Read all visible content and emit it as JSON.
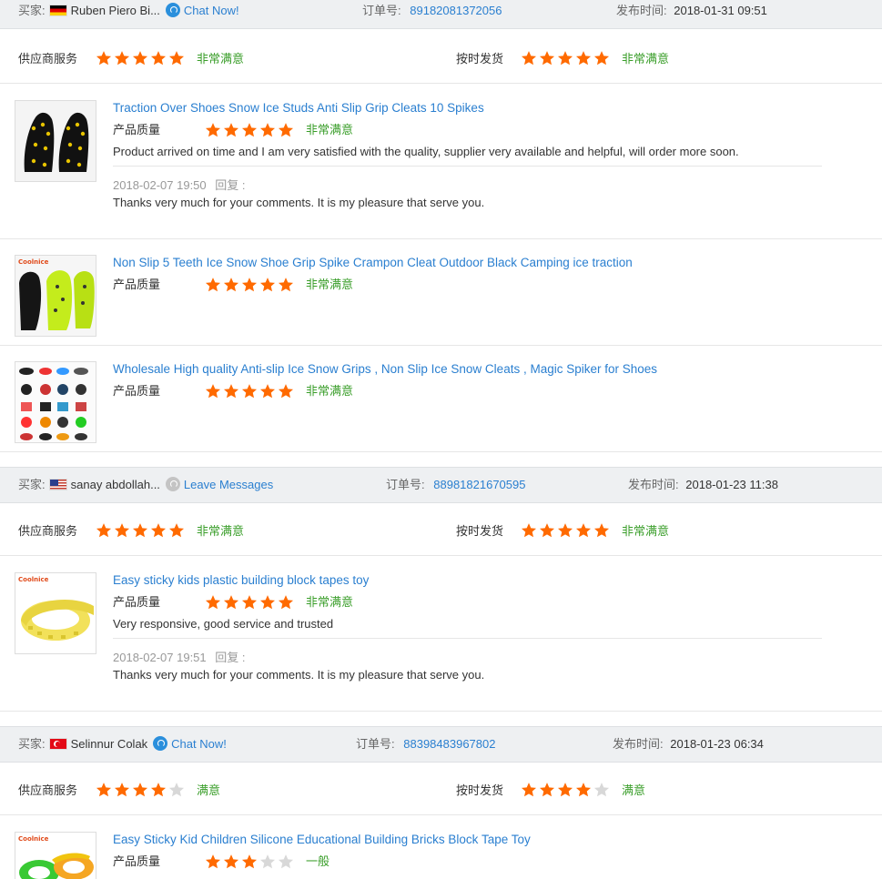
{
  "labels": {
    "buyer": "买家:",
    "order_no": "订单号:",
    "publish_time": "发布时间:",
    "supplier_service": "供应商服务",
    "on_time_delivery": "按时发货",
    "product_quality": "产品质量",
    "reply": "回复 :"
  },
  "colors": {
    "star": "#ff6a00",
    "link": "#2a7fd0",
    "verdict": "#3a9e2a",
    "header_bg": "#eef0f2"
  },
  "orders": [
    {
      "buyer_name": "Ruben Piero Bi...",
      "country_flag": "germany-flag",
      "contact_icon": "chat-icon",
      "contact_label": "Chat Now!",
      "order_number": "89182081372056",
      "publish_time": "2018-01-31 09:51",
      "supplier_service": {
        "stars": 5,
        "verdict": "非常满意"
      },
      "on_time_delivery": {
        "stars": 5,
        "verdict": "非常满意"
      },
      "products": [
        {
          "title": "Traction Over Shoes Snow Ice Studs Anti Slip Grip Cleats 10 Spikes",
          "quality_stars": 5,
          "quality_verdict": "非常满意",
          "review": "Product arrived on time and I am very satisfied with the quality, supplier very available and helpful, will order more soon.",
          "reply_date": "2018-02-07 19:50",
          "reply": "Thanks very much for your comments. It is my pleasure that serve you."
        },
        {
          "title": "Non Slip 5 Teeth Ice Snow Shoe Grip Spike Crampon Cleat Outdoor Black Camping ice traction",
          "thumb_brand": "Coolnice",
          "quality_stars": 5,
          "quality_verdict": "非常满意"
        },
        {
          "title": "Wholesale High quality Anti-slip Ice Snow Grips , Non Slip Ice Snow Cleats , Magic Spiker for Shoes",
          "quality_stars": 5,
          "quality_verdict": "非常满意"
        }
      ]
    },
    {
      "buyer_name": "sanay abdollah...",
      "country_flag": "usa-flag",
      "contact_icon": "message-icon",
      "contact_label": "Leave Messages",
      "order_number": "88981821670595",
      "publish_time": "2018-01-23 11:38",
      "supplier_service": {
        "stars": 5,
        "verdict": "非常满意"
      },
      "on_time_delivery": {
        "stars": 5,
        "verdict": "非常满意"
      },
      "products": [
        {
          "title": "Easy sticky kids plastic building block tapes toy",
          "thumb_brand": "Coolnice",
          "quality_stars": 5,
          "quality_verdict": "非常满意",
          "review": "Very responsive, good service and trusted",
          "reply_date": "2018-02-07 19:51",
          "reply": "Thanks very much for your comments. It is my pleasure that serve you."
        }
      ]
    },
    {
      "buyer_name": "Selinnur Colak",
      "country_flag": "turkey-flag",
      "contact_icon": "chat-icon",
      "contact_label": "Chat Now!",
      "order_number": "88398483967802",
      "publish_time": "2018-01-23 06:34",
      "supplier_service": {
        "stars": 4,
        "verdict": "满意"
      },
      "on_time_delivery": {
        "stars": 4,
        "verdict": "满意"
      },
      "products": [
        {
          "title": "Easy Sticky Kid Children Silicone Educational Building Bricks Block Tape Toy",
          "thumb_brand": "Coolnice",
          "quality_stars": 3,
          "quality_verdict": "一般"
        }
      ]
    }
  ]
}
